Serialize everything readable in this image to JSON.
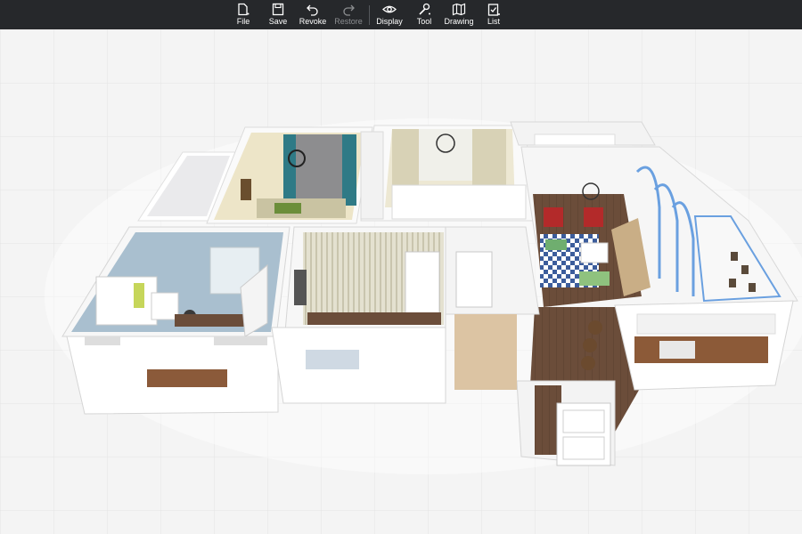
{
  "toolbar": {
    "items": [
      {
        "label": "File",
        "icon": "file-icon",
        "enabled": true
      },
      {
        "label": "Save",
        "icon": "save-icon",
        "enabled": true
      },
      {
        "label": "Revoke",
        "icon": "undo-icon",
        "enabled": true
      },
      {
        "label": "Restore",
        "icon": "redo-icon",
        "enabled": false
      },
      {
        "label": "Display",
        "icon": "eye-icon",
        "enabled": true
      },
      {
        "label": "Tool",
        "icon": "wrench-icon",
        "enabled": true
      },
      {
        "label": "Drawing",
        "icon": "map-icon",
        "enabled": true
      },
      {
        "label": "List",
        "icon": "checklist-icon",
        "enabled": true
      }
    ]
  },
  "colors": {
    "toolbar_bg": "#26282b",
    "toolbar_text": "#ffffff",
    "toolbar_disabled": "#8c8e91",
    "grid_bg": "#f4f4f4",
    "grid_line": "#e2e2e2",
    "wall": "#f7f7f7",
    "wood_floor": "#6b4d3a",
    "light_floor": "#d9c3a3",
    "blue_wall": "#a9bfcf",
    "stripe_wall": "#dcd9c8",
    "accent_blue": "#6aa0e0"
  }
}
